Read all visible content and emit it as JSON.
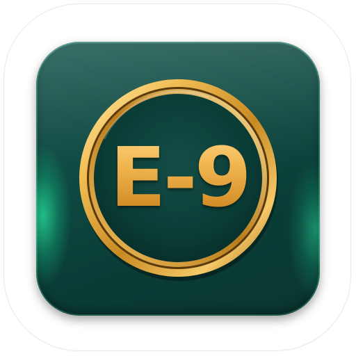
{
  "app_icon": {
    "badge_text": "E-9",
    "colors": {
      "tile_dark": "#0a3c36",
      "tile_mid": "#0f4a42",
      "tile_glow": "#28e6a0",
      "gold_light": "#ffd98a",
      "gold_mid": "#f0b44e",
      "gold_dark": "#b8741c"
    },
    "icons": [
      "gold-ring-icon"
    ]
  }
}
